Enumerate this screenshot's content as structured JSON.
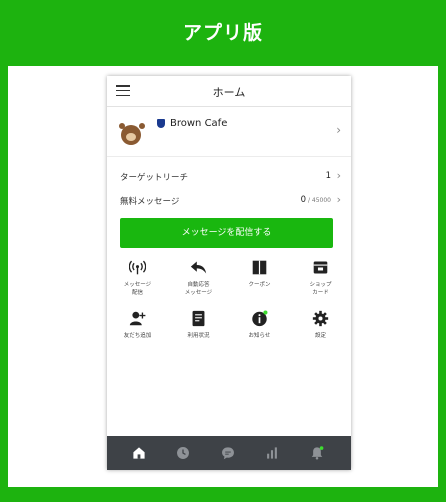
{
  "banner": {
    "title": "アプリ版"
  },
  "header": {
    "title": "ホーム"
  },
  "account": {
    "name": "Brown Cafe",
    "subtitle": " "
  },
  "stats": [
    {
      "label": "ターゲットリーチ",
      "value": "1",
      "suffix": ""
    },
    {
      "label": "無料メッセージ",
      "value": "0",
      "suffix": " / 45000"
    }
  ],
  "cta": {
    "label": "メッセージを配信する"
  },
  "menu": [
    {
      "label": "メッセージ\n配信",
      "icon": "broadcast-icon"
    },
    {
      "label": "自動応答\nメッセージ",
      "icon": "reply-arrow-icon"
    },
    {
      "label": "クーポン",
      "icon": "coupon-icon"
    },
    {
      "label": "ショップ\nカード",
      "icon": "shop-card-icon"
    },
    {
      "label": "友だち追加",
      "icon": "add-friend-icon"
    },
    {
      "label": "利用状況",
      "icon": "usage-icon"
    },
    {
      "label": "お知らせ",
      "icon": "info-icon"
    },
    {
      "label": "設定",
      "icon": "gear-icon"
    }
  ],
  "bottom_nav": [
    {
      "icon": "home-icon",
      "active": true
    },
    {
      "icon": "clock-icon",
      "active": false
    },
    {
      "icon": "chat-icon",
      "active": false
    },
    {
      "icon": "chart-icon",
      "active": false
    },
    {
      "icon": "bell-icon",
      "active": false,
      "badge": true
    }
  ],
  "colors": {
    "brand": "#1db30f",
    "cta": "#19b70f",
    "navbar": "#3e4247",
    "badge": "#3ddc2f"
  }
}
